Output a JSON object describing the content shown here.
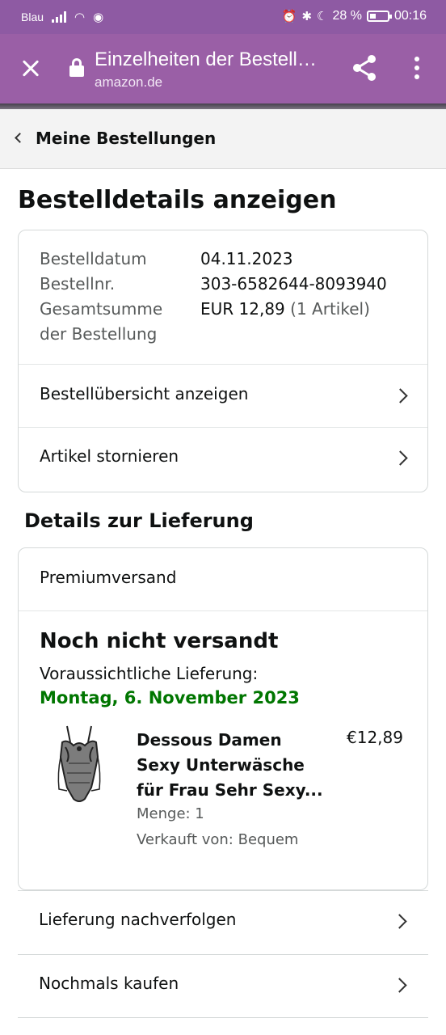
{
  "status_bar": {
    "carrier": "Blau",
    "battery": "28 %",
    "time": "00:16"
  },
  "app_bar": {
    "title": "Einzelheiten der Bestell…",
    "url": "amazon.de",
    "close_icon": "close-icon",
    "share_icon": "share-icon",
    "more_icon": "more-vert-icon"
  },
  "breadcrumb": {
    "label": "Meine Bestellungen"
  },
  "page_title": "Bestelldetails anzeigen",
  "order_summary": {
    "date_label": "Bestelldatum",
    "date_value": "04.11.2023",
    "number_label": "Bestellnr.",
    "number_value": "303-6582644-8093940",
    "total_label_line1": "Gesamtsumme",
    "total_label_line2": "der Bestellung",
    "total_value": "EUR 12,89",
    "total_items": "(1 Artikel)",
    "overview_link": "Bestellübersicht anzeigen",
    "cancel_link": "Artikel stornieren"
  },
  "delivery": {
    "section_title": "Details zur Lieferung",
    "shipping_type": "Premiumversand",
    "status": "Noch nicht versandt",
    "estimate_label": "Voraussichtliche Lieferung:",
    "estimate_date": "Montag, 6. November 2023",
    "product": {
      "name": "Dessous Damen Sexy Unterwäsche für Frau Sehr Sexy...",
      "price": "€12,89",
      "quantity": "Menge: 1",
      "seller": "Verkauft von: Bequem"
    },
    "colors": {
      "estimate_date": "#007600"
    }
  },
  "actions": {
    "track": "Lieferung nachverfolgen",
    "buy_again": "Nochmals kaufen"
  },
  "colors": {
    "status_bar": "#8e5aa3",
    "app_bar": "#9a5fa6"
  }
}
